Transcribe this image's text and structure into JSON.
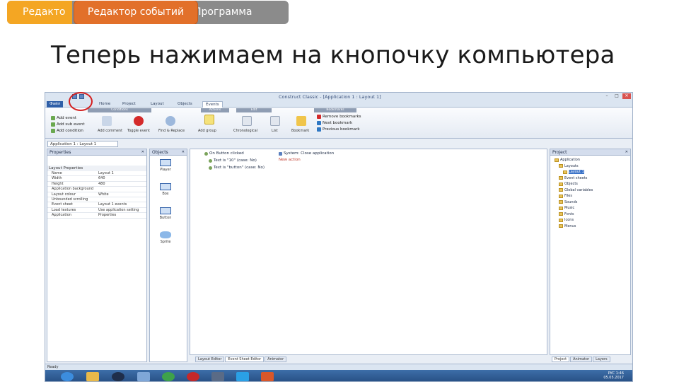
{
  "slide": {
    "tabs": [
      {
        "label": "Редакто"
      },
      {
        "label": "Редактор событий"
      },
      {
        "label": "Программа"
      }
    ],
    "title": "Теперь нажимаем на кнопочку компьютера"
  },
  "app": {
    "window_title": "Construct Classic - [Application 1 : Layout 1]",
    "window_buttons": {
      "minimize": "–",
      "maximize": "□",
      "close": "✕"
    },
    "ribbon_tabs": [
      {
        "label": "Файл"
      },
      {
        "label": "Home"
      },
      {
        "label": "Project"
      },
      {
        "label": "Layout"
      },
      {
        "label": "Objects"
      },
      {
        "label": "Events"
      }
    ],
    "ribbon_groups": [
      "Conditions",
      "Actions",
      "Edit",
      "Bookmarks"
    ],
    "ribbon_small_left": [
      "Add event",
      "Add sub event",
      "Add condition"
    ],
    "ribbon_buttons": [
      "Add comment",
      "Toggle event",
      "Find & Replace",
      "Add group",
      "Chronological",
      "List",
      "Bookmark"
    ],
    "ribbon_small_right": [
      "Remove bookmarks",
      "Next bookmark",
      "Previous bookmark"
    ],
    "doc_tab": "Application 1 : Layout 1",
    "properties": {
      "title": "Properties",
      "section": "Layout Properties",
      "rows": [
        {
          "k": "Name",
          "v": "Layout 1"
        },
        {
          "k": "Width",
          "v": "640"
        },
        {
          "k": "Height",
          "v": "480"
        },
        {
          "k": "Application background",
          "v": ""
        },
        {
          "k": "Layout colour",
          "v": "White"
        },
        {
          "k": "Unbounded scrolling",
          "v": ""
        },
        {
          "k": "Event sheet",
          "v": "Layout 1 events"
        },
        {
          "k": "Load textures",
          "v": "Use application setting"
        },
        {
          "k": "Application",
          "v": "Properties"
        }
      ]
    },
    "objects": {
      "title": "Objects",
      "items": [
        "Player",
        "Box",
        "Button",
        "Sprite"
      ]
    },
    "events": {
      "conditions": [
        "On Button clicked",
        "Text is \"10\" (case: No)",
        "Text is \"button\" (case: No)"
      ],
      "actions": [
        "System: Close application",
        "New action"
      ]
    },
    "project": {
      "title": "Project",
      "tree": [
        "Application",
        "Layouts",
        "Layout 1",
        "Event sheets",
        "Objects",
        "Global variables",
        "Files",
        "Sounds",
        "Music",
        "Fonts",
        "Icons",
        "Menus"
      ]
    },
    "bottom_tabs_center": [
      "Layout Editor",
      "Event Sheet Editor",
      "Animator"
    ],
    "bottom_tabs_right": [
      "Project",
      "Animator",
      "Layers"
    ],
    "status": "Ready",
    "tray": {
      "lang": "РУС",
      "time": "1:46",
      "date": "05.05.2017"
    }
  },
  "colors": {
    "tab_left": "#f4a623",
    "tab_active": "#e2702a",
    "tab_bar": "#8b8b8b",
    "highlight_circle": "#d41f1f",
    "taskbar": "#2f5a92"
  }
}
